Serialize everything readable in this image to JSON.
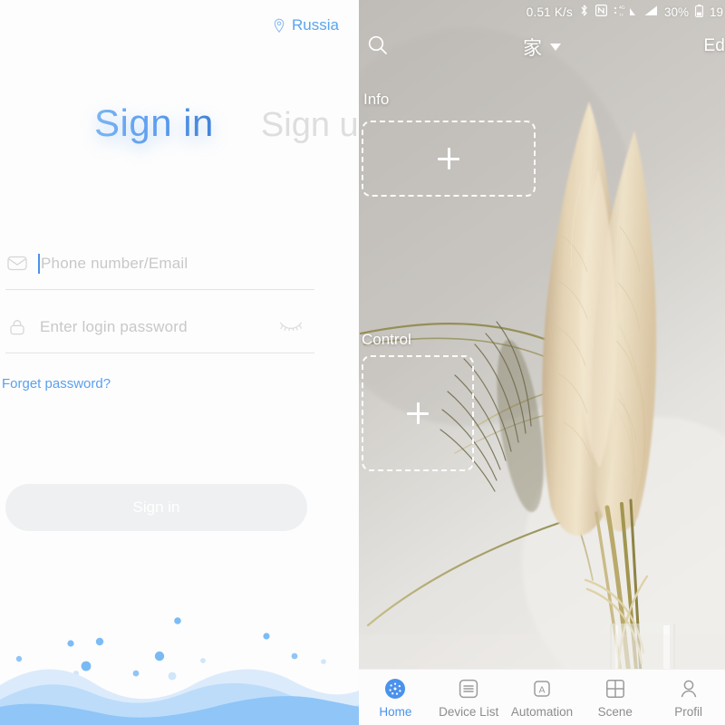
{
  "signin_panel": {
    "locale": {
      "icon": "location-pin-icon",
      "label": "Russia"
    },
    "tabs": {
      "active": "Sign in",
      "inactive": "Sign u"
    },
    "fields": [
      {
        "icon": "envelope-icon",
        "placeholder": "Phone number/Email",
        "value": "",
        "focused": true
      },
      {
        "icon": "lock-icon",
        "placeholder": "Enter login password",
        "value": "",
        "trailing_icon": "eye-closed-icon"
      }
    ],
    "forget_password": "Forget password?",
    "submit_label": "Sign in",
    "accent_color": "#4a92ec",
    "submit_bg_color": "#eef0f1",
    "wave_colors": [
      "#dcebfb",
      "#bddcfa",
      "#8fc5f7"
    ]
  },
  "app_panel": {
    "statusbar": {
      "network_speed": "0.51 K/s",
      "bluetooth_icon": "bluetooth-icon",
      "nfc_icon": "nfc-icon",
      "dual_sim_icon": "dual-sim-signal-icon",
      "network_label": "4G",
      "signal_icon": "signal-bars-icon",
      "battery_percent": "30%",
      "battery_icon": "battery-icon",
      "clock": "19"
    },
    "header": {
      "search_icon": "search-icon",
      "home_name": "家",
      "dropdown_icon": "chevron-down-icon",
      "edit_label": "Edi"
    },
    "sections": [
      {
        "label": "Info",
        "add_icon": "plus-icon"
      },
      {
        "label": "Control",
        "add_icon": "plus-icon"
      }
    ],
    "bottom_nav": {
      "active_index": 0,
      "active_color": "#4a92ec",
      "inactive_color": "#8d8d8d",
      "items": [
        {
          "label": "Home",
          "icon": "home-dots-icon"
        },
        {
          "label": "Device List",
          "icon": "list-icon"
        },
        {
          "label": "Automation",
          "icon": "letter-a-box-icon"
        },
        {
          "label": "Scene",
          "icon": "grid-icon"
        },
        {
          "label": "Profil",
          "icon": "person-icon"
        }
      ]
    }
  }
}
